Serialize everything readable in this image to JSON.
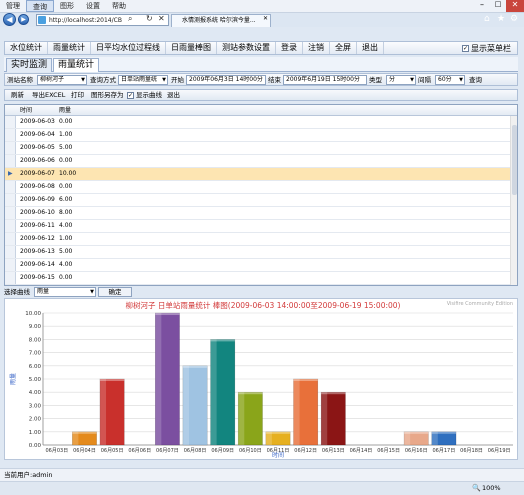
{
  "menu": [
    "管理",
    "查询",
    "图形",
    "设置",
    "帮助"
  ],
  "browser": {
    "url": "http://localhost:2014/CB",
    "tab_title": "水情测报系统 哈尔滨今量..."
  },
  "app_toolbar": {
    "items": [
      "水位统计",
      "雨量统计",
      "日平均水位过程线",
      "日雨量棒图",
      "测站参数设置",
      "登录",
      "注销",
      "全屏",
      "退出"
    ],
    "show_menu_label": "显示菜单栏",
    "show_menu_checked": true
  },
  "page_tabs": [
    "实时监测",
    "雨量统计"
  ],
  "query": {
    "station_label": "测站名称",
    "station_value": "柳树河子",
    "method_label": "查询方式",
    "method_value": "日单站雨量统",
    "start_label": "开始",
    "start_value": "2009年06月3日 14时00分",
    "end_label": "结束",
    "end_value": "2009年6月19日 15时00分",
    "type_label": "类型",
    "type_value": "分",
    "interval_label": "间隔",
    "interval_value": "60分",
    "query_button": "查询"
  },
  "toolbar2": {
    "refresh": "刷新",
    "export": "导出EXCEL",
    "print": "打印",
    "save_image": "图形另存为",
    "show_curve": "显示曲线",
    "exit": "退出"
  },
  "grid": {
    "headers": [
      "时间",
      "雨量"
    ],
    "rows": [
      [
        "2009-06-03",
        "0.00"
      ],
      [
        "2009-06-04",
        "1.00"
      ],
      [
        "2009-06-05",
        "5.00"
      ],
      [
        "2009-06-06",
        "0.00"
      ],
      [
        "2009-06-07",
        "10.00"
      ],
      [
        "2009-06-08",
        "0.00"
      ],
      [
        "2009-06-09",
        "6.00"
      ],
      [
        "2009-06-10",
        "8.00"
      ],
      [
        "2009-06-11",
        "4.00"
      ],
      [
        "2009-06-12",
        "1.00"
      ],
      [
        "2009-06-13",
        "5.00"
      ],
      [
        "2009-06-14",
        "4.00"
      ],
      [
        "2009-06-15",
        "0.00"
      ]
    ],
    "current_row": 4
  },
  "curve_select": {
    "label": "选择曲线",
    "value": "雨量",
    "confirm": "确定"
  },
  "chart_data": {
    "type": "bar",
    "title": "柳树河子 日单站雨量统计 棒图(2009-06-03 14:00:00至2009-06-19 15:00:00)",
    "watermark": "Visifire Community Edition",
    "xlabel": "时间",
    "ylabel": "雨量",
    "ylim": [
      0,
      10
    ],
    "yticks": [
      "0.00",
      "1.00",
      "2.00",
      "3.00",
      "4.00",
      "5.00",
      "6.00",
      "7.00",
      "8.00",
      "9.00",
      "10.00"
    ],
    "categories": [
      "06月03日",
      "06月04日",
      "06月05日",
      "06月06日",
      "06月07日",
      "06月08日",
      "06月09日",
      "06月10日",
      "06月11日",
      "06月12日",
      "06月13日",
      "06月14日",
      "06月15日",
      "06月16日",
      "06月17日",
      "06月18日",
      "06月19日"
    ],
    "values": [
      0,
      1,
      5,
      0,
      10,
      6,
      8,
      4,
      1,
      5,
      4,
      0,
      0,
      1,
      1,
      0,
      0
    ],
    "colors": [
      "#e0e0e0",
      "#e48a1c",
      "#c9302c",
      "#e0e0e0",
      "#7b4fa0",
      "#9fc3e2",
      "#12857f",
      "#8aa51a",
      "#e6b020",
      "#e8703a",
      "#8b1515",
      "#e0e0e0",
      "#e0e0e0",
      "#e8a88a",
      "#2f6fbf",
      "#e0e0e0",
      "#e0e0e0"
    ],
    "grid": true
  },
  "status": {
    "user": "当前用户:admin",
    "zoom": "100%"
  }
}
